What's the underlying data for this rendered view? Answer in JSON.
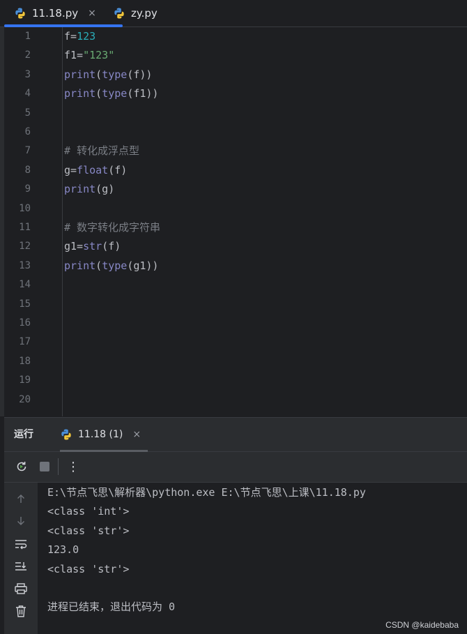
{
  "editor_tabs": [
    {
      "label": "11.18.py",
      "close": "×"
    },
    {
      "label": "zy.py"
    }
  ],
  "code_lines": [
    {
      "n": "1",
      "tokens": [
        {
          "t": "f=",
          "c": "default"
        },
        {
          "t": "123",
          "c": "number"
        }
      ]
    },
    {
      "n": "2",
      "tokens": [
        {
          "t": "f1=",
          "c": "default"
        },
        {
          "t": "\"123\"",
          "c": "string"
        }
      ]
    },
    {
      "n": "3",
      "tokens": [
        {
          "t": "print",
          "c": "builtin"
        },
        {
          "t": "(",
          "c": "default"
        },
        {
          "t": "type",
          "c": "builtin"
        },
        {
          "t": "(f))",
          "c": "default"
        }
      ]
    },
    {
      "n": "4",
      "tokens": [
        {
          "t": "print",
          "c": "builtin"
        },
        {
          "t": "(",
          "c": "default"
        },
        {
          "t": "type",
          "c": "builtin"
        },
        {
          "t": "(f1))",
          "c": "default"
        }
      ]
    },
    {
      "n": "5",
      "tokens": []
    },
    {
      "n": "6",
      "tokens": []
    },
    {
      "n": "7",
      "tokens": [
        {
          "t": "# 转化成浮点型",
          "c": "comment"
        }
      ]
    },
    {
      "n": "8",
      "tokens": [
        {
          "t": "g=",
          "c": "default"
        },
        {
          "t": "float",
          "c": "builtin"
        },
        {
          "t": "(f)",
          "c": "default"
        }
      ]
    },
    {
      "n": "9",
      "tokens": [
        {
          "t": "print",
          "c": "builtin"
        },
        {
          "t": "(g)",
          "c": "default"
        }
      ]
    },
    {
      "n": "10",
      "tokens": []
    },
    {
      "n": "11",
      "tokens": [
        {
          "t": "# 数字转化成字符串",
          "c": "comment"
        }
      ]
    },
    {
      "n": "12",
      "tokens": [
        {
          "t": "g1=",
          "c": "default"
        },
        {
          "t": "str",
          "c": "builtin"
        },
        {
          "t": "(f)",
          "c": "default"
        }
      ]
    },
    {
      "n": "13",
      "tokens": [
        {
          "t": "print",
          "c": "builtin"
        },
        {
          "t": "(",
          "c": "default"
        },
        {
          "t": "type",
          "c": "builtin"
        },
        {
          "t": "(g1))",
          "c": "default"
        }
      ]
    },
    {
      "n": "14",
      "tokens": []
    },
    {
      "n": "15",
      "tokens": []
    },
    {
      "n": "16",
      "tokens": []
    },
    {
      "n": "17",
      "tokens": []
    },
    {
      "n": "18",
      "tokens": []
    },
    {
      "n": "19",
      "tokens": []
    },
    {
      "n": "20",
      "tokens": []
    }
  ],
  "run_panel": {
    "label": "运行",
    "tab_label": "11.18 (1)",
    "tab_close": "×",
    "more_label": "⋮"
  },
  "console_output": [
    "E:\\节点飞思\\解析器\\python.exe E:\\节点飞思\\上课\\11.18.py",
    "<class 'int'>",
    "<class 'str'>",
    "123.0",
    "<class 'str'>",
    "",
    "进程已结束，退出代码为 0"
  ],
  "watermark": "CSDN @kaidebaba",
  "colors": {
    "accent": "#3574f0",
    "builtin": "#8888c6",
    "number": "#2aacb8",
    "string": "#6aab73",
    "comment": "#7a7e85"
  }
}
